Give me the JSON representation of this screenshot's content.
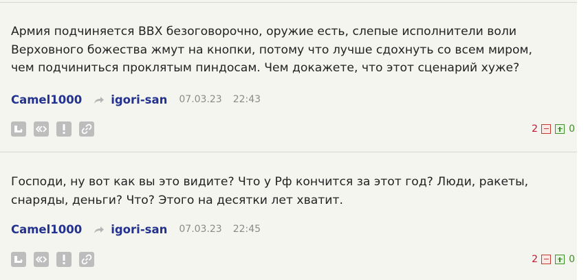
{
  "comments": [
    {
      "text_lines": [
        "Армия подчиняется ВВХ безоговорочно, оружие есть, слепые исполнители воли",
        "Верховного божества жмут на кнопки, потому что лучше сдохнуть со всем миром,",
        "чем подчиниться проклятым пиндосам. Чем докажете, что этот сценарий хуже?"
      ],
      "author": "Camel1000",
      "reply_to": "igori-san",
      "date": "07.03.23",
      "time": "22:43",
      "votes_minus": "2",
      "votes_plus": "0"
    },
    {
      "text_lines": [
        "Господи, ну вот как вы это видите? Что у Рф кончится за этот год? Люди, ракеты,",
        "снаряды, деньги? Что? Этого на десятки лет хватит."
      ],
      "author": "Camel1000",
      "reply_to": "igori-san",
      "date": "07.03.23",
      "time": "22:45",
      "votes_minus": "2",
      "votes_plus": "0"
    }
  ],
  "icons": {
    "reply_arrow": "reply-arrow-icon",
    "action_buttons": [
      "reply-icon",
      "quote-icon",
      "report-icon",
      "link-icon"
    ],
    "vote_minus": "minus-icon",
    "vote_plus": "plus-icon"
  },
  "colors": {
    "author": "#23328f",
    "minus": "#c0392b",
    "plus": "#3f8f2a",
    "button_gray": "#bdbdbd"
  }
}
